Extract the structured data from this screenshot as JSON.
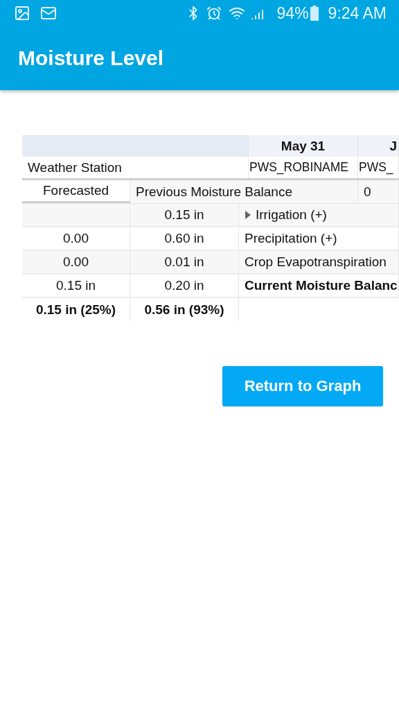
{
  "status_bar": {
    "battery": "94%",
    "time": "9:24 AM"
  },
  "app_bar": {
    "title": "Moisture Level"
  },
  "table": {
    "rows": [
      {
        "kind": "header",
        "cells": [
          "",
          "May 31",
          "J"
        ]
      },
      {
        "kind": "station",
        "cells": [
          "Weather Station",
          "PWS_ROBINAME",
          "PWS_"
        ]
      },
      {
        "kind": "section",
        "cells": [
          "Forecasted",
          "Previous Moisture Balance",
          "0"
        ]
      },
      {
        "kind": "data",
        "expanded": false,
        "cells": [
          "",
          "0.15 in",
          "Irrigation (+)"
        ]
      },
      {
        "kind": "data",
        "cells": [
          "0.00",
          "0.60 in",
          "Precipitation (+)"
        ]
      },
      {
        "kind": "data",
        "cells": [
          "0.00",
          "0.01 in",
          "Crop Evapotranspiration"
        ]
      },
      {
        "kind": "current",
        "cells": [
          "0.15 in",
          "0.20 in",
          "Current Moisture Balanc"
        ]
      },
      {
        "kind": "total",
        "cells": [
          "0.15 in (25%)",
          "0.56 in (93%)",
          ""
        ]
      }
    ]
  },
  "button": {
    "label": "Return to Graph"
  }
}
